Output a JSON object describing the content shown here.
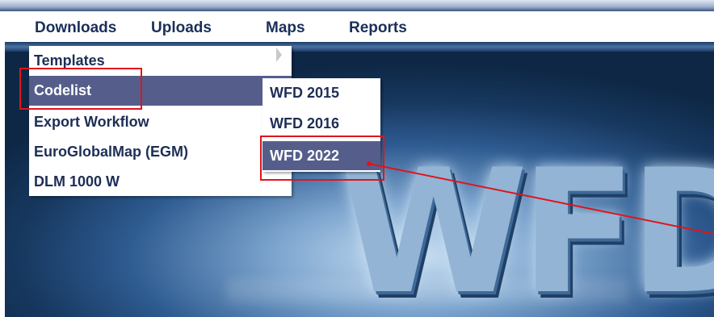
{
  "menu": {
    "top_items": [
      {
        "label": "Downloads"
      },
      {
        "label": "Uploads"
      },
      {
        "label": "Maps"
      },
      {
        "label": "Reports"
      }
    ],
    "downloads_dropdown": [
      {
        "label": "Templates",
        "has_submenu": true
      },
      {
        "label": "Codelist",
        "active": true
      },
      {
        "label": "Export Workflow"
      },
      {
        "label": "EuroGlobalMap (EGM)"
      },
      {
        "label": "DLM 1000 W"
      }
    ],
    "codelist_submenu": [
      {
        "label": "WFD 2015"
      },
      {
        "label": "WFD 2016"
      },
      {
        "label": "WFD 2022",
        "active": true
      }
    ]
  },
  "banner": {
    "logo_text": "WFD"
  },
  "colors": {
    "menu_text": "#1a2f5a",
    "active_item_bg": "#555e8b",
    "highlight_red": "#e0141b",
    "banner_dark": "#0e2745"
  },
  "annotations": [
    {
      "target": "Codelist",
      "style": "red-box"
    },
    {
      "target": "WFD 2022",
      "style": "red-box-with-arrow"
    }
  ]
}
